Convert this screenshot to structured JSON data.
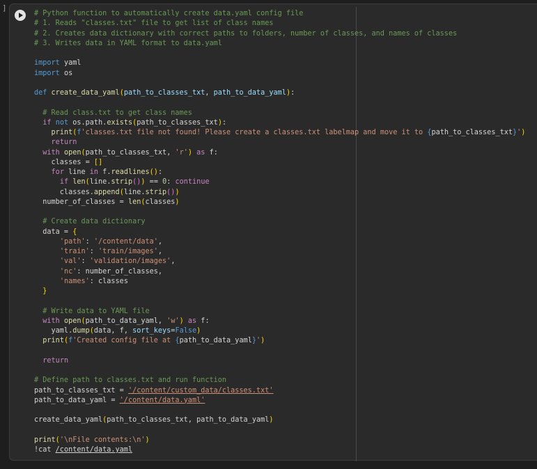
{
  "cell": {
    "execution_count": "]",
    "run_icon": "play-icon"
  },
  "code_lines": [
    [
      {
        "c": "comment",
        "t": "# Python function to automatically create data.yaml config file"
      }
    ],
    [
      {
        "c": "comment",
        "t": "# 1. Reads \"classes.txt\" file to get list of class names"
      }
    ],
    [
      {
        "c": "comment",
        "t": "# 2. Creates data dictionary with correct paths to folders, number of classes, and names of classes"
      }
    ],
    [
      {
        "c": "comment",
        "t": "# 3. Writes data in YAML format to data.yaml"
      }
    ],
    [],
    [
      {
        "c": "kw",
        "t": "import"
      },
      {
        "c": "plain",
        "t": " yaml"
      }
    ],
    [
      {
        "c": "kw",
        "t": "import"
      },
      {
        "c": "plain",
        "t": " os"
      }
    ],
    [],
    [
      {
        "c": "kw",
        "t": "def"
      },
      {
        "c": "plain",
        "t": " "
      },
      {
        "c": "fn",
        "t": "create_data_yaml"
      },
      {
        "c": "br1",
        "t": "("
      },
      {
        "c": "param",
        "t": "path_to_classes_txt"
      },
      {
        "c": "plain",
        "t": ", "
      },
      {
        "c": "param",
        "t": "path_to_data_yaml"
      },
      {
        "c": "br1",
        "t": ")"
      },
      {
        "c": "plain",
        "t": ":"
      }
    ],
    [],
    [
      {
        "c": "comment",
        "t": "  # Read class.txt to get class names"
      }
    ],
    [
      {
        "c": "plain",
        "t": "  "
      },
      {
        "c": "ctrl",
        "t": "if"
      },
      {
        "c": "plain",
        "t": " "
      },
      {
        "c": "kw",
        "t": "not"
      },
      {
        "c": "plain",
        "t": " os.path."
      },
      {
        "c": "fn",
        "t": "exists"
      },
      {
        "c": "br1",
        "t": "("
      },
      {
        "c": "plain",
        "t": "path_to_classes_txt"
      },
      {
        "c": "br1",
        "t": ")"
      },
      {
        "c": "plain",
        "t": ":"
      }
    ],
    [
      {
        "c": "plain",
        "t": "    "
      },
      {
        "c": "fn",
        "t": "print"
      },
      {
        "c": "br1",
        "t": "("
      },
      {
        "c": "kw",
        "t": "f"
      },
      {
        "c": "str",
        "t": "'classes.txt file not found! Please create a classes.txt labelmap and move it to "
      },
      {
        "c": "kw",
        "t": "{"
      },
      {
        "c": "plain",
        "t": "path_to_classes_txt"
      },
      {
        "c": "kw",
        "t": "}"
      },
      {
        "c": "str",
        "t": "'"
      },
      {
        "c": "br1",
        "t": ")"
      }
    ],
    [
      {
        "c": "plain",
        "t": "    "
      },
      {
        "c": "ctrl",
        "t": "return"
      }
    ],
    [
      {
        "c": "plain",
        "t": "  "
      },
      {
        "c": "ctrl",
        "t": "with"
      },
      {
        "c": "plain",
        "t": " "
      },
      {
        "c": "fn",
        "t": "open"
      },
      {
        "c": "br1",
        "t": "("
      },
      {
        "c": "plain",
        "t": "path_to_classes_txt, "
      },
      {
        "c": "str",
        "t": "'r'"
      },
      {
        "c": "br1",
        "t": ")"
      },
      {
        "c": "plain",
        "t": " "
      },
      {
        "c": "ctrl",
        "t": "as"
      },
      {
        "c": "plain",
        "t": " f:"
      }
    ],
    [
      {
        "c": "plain",
        "t": "    classes = "
      },
      {
        "c": "br1",
        "t": "[]"
      }
    ],
    [
      {
        "c": "plain",
        "t": "    "
      },
      {
        "c": "ctrl",
        "t": "for"
      },
      {
        "c": "plain",
        "t": " line "
      },
      {
        "c": "ctrl",
        "t": "in"
      },
      {
        "c": "plain",
        "t": " f."
      },
      {
        "c": "fn",
        "t": "readlines"
      },
      {
        "c": "br1",
        "t": "()"
      },
      {
        "c": "plain",
        "t": ":"
      }
    ],
    [
      {
        "c": "plain",
        "t": "      "
      },
      {
        "c": "ctrl",
        "t": "if"
      },
      {
        "c": "plain",
        "t": " "
      },
      {
        "c": "fn",
        "t": "len"
      },
      {
        "c": "br1",
        "t": "("
      },
      {
        "c": "plain",
        "t": "line."
      },
      {
        "c": "fn",
        "t": "strip"
      },
      {
        "c": "br2",
        "t": "()"
      },
      {
        "c": "br1",
        "t": ")"
      },
      {
        "c": "plain",
        "t": " == "
      },
      {
        "c": "num",
        "t": "0"
      },
      {
        "c": "plain",
        "t": ": "
      },
      {
        "c": "ctrl",
        "t": "continue"
      }
    ],
    [
      {
        "c": "plain",
        "t": "      classes."
      },
      {
        "c": "fn",
        "t": "append"
      },
      {
        "c": "br1",
        "t": "("
      },
      {
        "c": "plain",
        "t": "line."
      },
      {
        "c": "fn",
        "t": "strip"
      },
      {
        "c": "br2",
        "t": "()"
      },
      {
        "c": "br1",
        "t": ")"
      }
    ],
    [
      {
        "c": "plain",
        "t": "  number_of_classes = "
      },
      {
        "c": "fn",
        "t": "len"
      },
      {
        "c": "br1",
        "t": "("
      },
      {
        "c": "plain",
        "t": "classes"
      },
      {
        "c": "br1",
        "t": ")"
      }
    ],
    [],
    [
      {
        "c": "comment",
        "t": "  # Create data dictionary"
      }
    ],
    [
      {
        "c": "plain",
        "t": "  data = "
      },
      {
        "c": "br1",
        "t": "{"
      }
    ],
    [
      {
        "c": "plain",
        "t": "      "
      },
      {
        "c": "str",
        "t": "'path'"
      },
      {
        "c": "plain",
        "t": ": "
      },
      {
        "c": "str",
        "t": "'/content/data'"
      },
      {
        "c": "plain",
        "t": ","
      }
    ],
    [
      {
        "c": "plain",
        "t": "      "
      },
      {
        "c": "str",
        "t": "'train'"
      },
      {
        "c": "plain",
        "t": ": "
      },
      {
        "c": "str",
        "t": "'train/images'"
      },
      {
        "c": "plain",
        "t": ","
      }
    ],
    [
      {
        "c": "plain",
        "t": "      "
      },
      {
        "c": "str",
        "t": "'val'"
      },
      {
        "c": "plain",
        "t": ": "
      },
      {
        "c": "str",
        "t": "'validation/images'"
      },
      {
        "c": "plain",
        "t": ","
      }
    ],
    [
      {
        "c": "plain",
        "t": "      "
      },
      {
        "c": "str",
        "t": "'nc'"
      },
      {
        "c": "plain",
        "t": ": number_of_classes,"
      }
    ],
    [
      {
        "c": "plain",
        "t": "      "
      },
      {
        "c": "str",
        "t": "'names'"
      },
      {
        "c": "plain",
        "t": ": classes"
      }
    ],
    [
      {
        "c": "plain",
        "t": "  "
      },
      {
        "c": "br1",
        "t": "}"
      }
    ],
    [],
    [
      {
        "c": "comment",
        "t": "  # Write data to YAML file"
      }
    ],
    [
      {
        "c": "plain",
        "t": "  "
      },
      {
        "c": "ctrl",
        "t": "with"
      },
      {
        "c": "plain",
        "t": " "
      },
      {
        "c": "fn",
        "t": "open"
      },
      {
        "c": "br1",
        "t": "("
      },
      {
        "c": "plain",
        "t": "path_to_data_yaml, "
      },
      {
        "c": "str",
        "t": "'w'"
      },
      {
        "c": "br1",
        "t": ")"
      },
      {
        "c": "plain",
        "t": " "
      },
      {
        "c": "ctrl",
        "t": "as"
      },
      {
        "c": "plain",
        "t": " f:"
      }
    ],
    [
      {
        "c": "plain",
        "t": "    yaml."
      },
      {
        "c": "fn",
        "t": "dump"
      },
      {
        "c": "br1",
        "t": "("
      },
      {
        "c": "plain",
        "t": "data, f, "
      },
      {
        "c": "param",
        "t": "sort_keys"
      },
      {
        "c": "plain",
        "t": "="
      },
      {
        "c": "kw",
        "t": "False"
      },
      {
        "c": "br1",
        "t": ")"
      }
    ],
    [
      {
        "c": "plain",
        "t": "  "
      },
      {
        "c": "fn",
        "t": "print"
      },
      {
        "c": "br1",
        "t": "("
      },
      {
        "c": "kw",
        "t": "f"
      },
      {
        "c": "str",
        "t": "'Created config file at "
      },
      {
        "c": "kw",
        "t": "{"
      },
      {
        "c": "plain",
        "t": "path_to_data_yaml"
      },
      {
        "c": "kw",
        "t": "}"
      },
      {
        "c": "str",
        "t": "'"
      },
      {
        "c": "br1",
        "t": ")"
      }
    ],
    [],
    [
      {
        "c": "plain",
        "t": "  "
      },
      {
        "c": "ctrl",
        "t": "return"
      }
    ],
    [],
    [
      {
        "c": "comment",
        "t": "# Define path to classes.txt and run function"
      }
    ],
    [
      {
        "c": "plain",
        "t": "path_to_classes_txt = "
      },
      {
        "c": "link",
        "t": "'/content/custom_data/classes.txt'"
      }
    ],
    [
      {
        "c": "plain",
        "t": "path_to_data_yaml = "
      },
      {
        "c": "link",
        "t": "'/content/data.yaml'"
      }
    ],
    [],
    [
      {
        "c": "plain",
        "t": "create_data_yaml"
      },
      {
        "c": "br1",
        "t": "("
      },
      {
        "c": "plain",
        "t": "path_to_classes_txt, path_to_data_yaml"
      },
      {
        "c": "br1",
        "t": ")"
      }
    ],
    [],
    [
      {
        "c": "fn",
        "t": "print"
      },
      {
        "c": "br1",
        "t": "("
      },
      {
        "c": "str",
        "t": "'\\nFile contents:\\n'"
      },
      {
        "c": "br1",
        "t": ")"
      }
    ],
    [
      {
        "c": "plain",
        "t": "!cat "
      },
      {
        "c": "link-plain",
        "t": "/content/data.yaml"
      }
    ]
  ]
}
